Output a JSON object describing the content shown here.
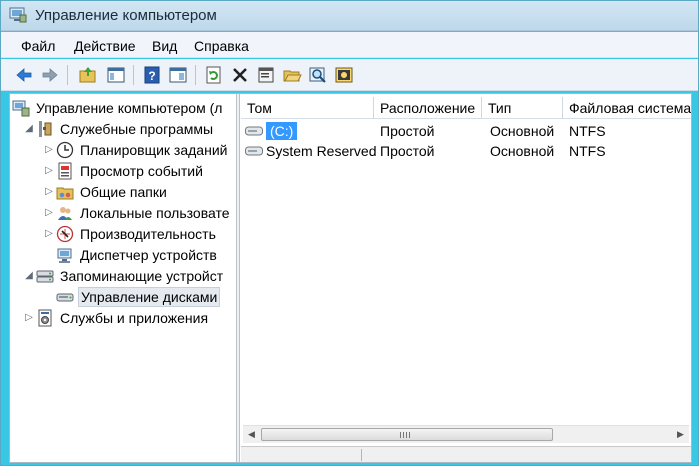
{
  "window": {
    "title": "Управление компьютером"
  },
  "menu": [
    "Файл",
    "Действие",
    "Вид",
    "Справка"
  ],
  "toolbar": [
    "back-icon",
    "forward-icon",
    "up-folder-icon",
    "show-hide-tree-icon",
    "help-icon",
    "show-hide-action-pane-icon",
    "refresh-icon",
    "delete-icon",
    "properties-icon",
    "open-folder-icon",
    "search-icon",
    "settings-icon"
  ],
  "tree": [
    {
      "label": "Управление компьютером (л",
      "icon": "computer-management-icon",
      "arrow": "",
      "level": 0
    },
    {
      "label": "Служебные программы",
      "icon": "system-tools-icon",
      "arrow": "expanded",
      "level": 1
    },
    {
      "label": "Планировщик заданий",
      "icon": "task-scheduler-icon",
      "arrow": "collapsed",
      "level": 2
    },
    {
      "label": "Просмотр событий",
      "icon": "event-viewer-icon",
      "arrow": "collapsed",
      "level": 2
    },
    {
      "label": "Общие папки",
      "icon": "shared-folders-icon",
      "arrow": "collapsed",
      "level": 2
    },
    {
      "label": "Локальные пользовате",
      "icon": "local-users-icon",
      "arrow": "collapsed",
      "level": 2
    },
    {
      "label": "Производительность",
      "icon": "performance-icon",
      "arrow": "collapsed",
      "level": 2
    },
    {
      "label": "Диспетчер устройств",
      "icon": "device-manager-icon",
      "arrow": "",
      "level": 2
    },
    {
      "label": "Запоминающие устройст",
      "icon": "storage-icon",
      "arrow": "expanded",
      "level": 1
    },
    {
      "label": "Управление дисками",
      "icon": "disk-management-icon",
      "arrow": "",
      "level": 2,
      "selected": true
    },
    {
      "label": "Службы и приложения",
      "icon": "services-apps-icon",
      "arrow": "collapsed",
      "level": 1
    }
  ],
  "volumes": {
    "columns": [
      "Том",
      "Расположение",
      "Тип",
      "Файловая система"
    ],
    "rows": [
      {
        "name": "(C:)",
        "layout": "Простой",
        "type": "Основной",
        "fs": "NTFS",
        "selected": true
      },
      {
        "name": "System Reserved",
        "layout": "Простой",
        "type": "Основной",
        "fs": "NTFS"
      }
    ]
  },
  "colors": {
    "accent": "#3399ff",
    "background": "#39c7e6"
  }
}
